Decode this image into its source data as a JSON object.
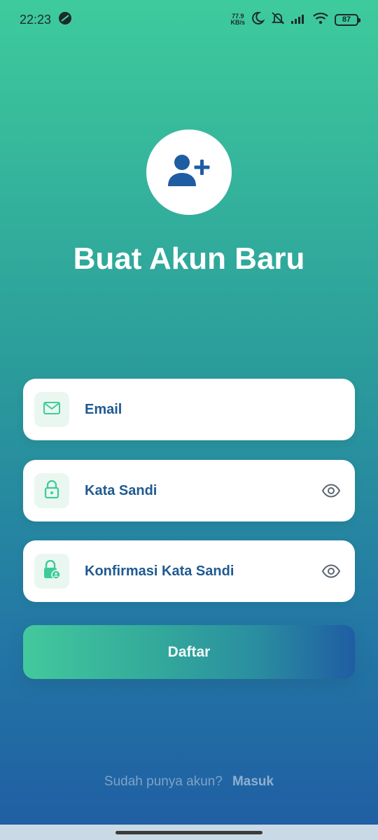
{
  "status_bar": {
    "time": "22:23",
    "speed_value": "77.9",
    "speed_unit": "KB/s",
    "battery": "87",
    "icons": [
      "app-notification-icon",
      "moon-icon",
      "mute-icon",
      "signal-icon",
      "wifi-icon",
      "battery-icon"
    ]
  },
  "header": {
    "icon": "person-add-icon",
    "title": "Buat Akun Baru"
  },
  "form": {
    "email": {
      "label": "Email",
      "icon": "mail-icon"
    },
    "password": {
      "label": "Kata Sandi",
      "icon": "lock-icon",
      "toggle_icon": "eye-icon"
    },
    "confirm_password": {
      "label": "Konfirmasi Kata Sandi",
      "icon": "lock-user-icon",
      "toggle_icon": "eye-icon"
    },
    "submit_label": "Daftar"
  },
  "footer": {
    "question": "Sudah punya akun?",
    "link": "Masuk"
  },
  "colors": {
    "gradient_top": "#3ecb9c",
    "gradient_bottom": "#1f5da3",
    "primary_text": "#1f5a91",
    "icon_green": "#3ecb9c",
    "icon_bg": "#eaf7f1"
  }
}
